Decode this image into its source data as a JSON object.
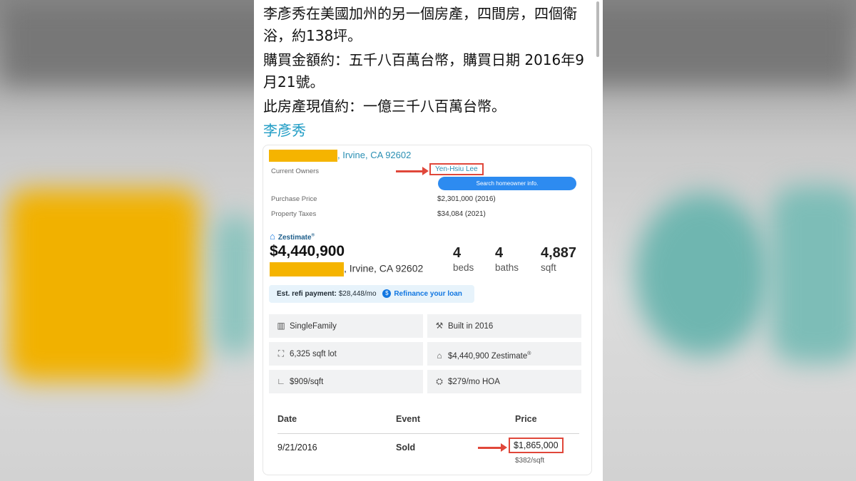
{
  "post": {
    "line1": "李彥秀在美國加州的另一個房產，四間房，四個衛浴，約138坪。",
    "line2": "購買金額約：五千八百萬台幣，購買日期 2016年9月21號。",
    "line3": "此房產現值約：一億三千八百萬台幣。",
    "author_tag": "李彥秀"
  },
  "card": {
    "top_address": ", Irvine, CA 92602",
    "current_owners_label": "Current Owners",
    "owner_name": "Yen-Hsiu Lee",
    "search_button": "Search homeowner info.",
    "purchase_price_label": "Purchase Price",
    "purchase_price_value": "$2,301,000 (2016)",
    "property_taxes_label": "Property Taxes",
    "property_taxes_value": "$34,084 (2021)",
    "zestimate_label": "Zestimate",
    "zestimate_reg": "®",
    "zestimate_price": "$4,440,900",
    "address": ", Irvine, CA 92602",
    "beds_num": "4",
    "beds_label": "beds",
    "baths_num": "4",
    "baths_label": "baths",
    "sqft_num": "4,887",
    "sqft_label": "sqft",
    "refi_label": "Est. refi payment:",
    "refi_value": "$28,448/mo",
    "refi_coin": "$",
    "refi_link": "Refinance your loan",
    "facts": {
      "type": "SingleFamily",
      "built": "Built in 2016",
      "lot": "6,325 sqft lot",
      "zest_fact": "$4,440,900 Zestimate",
      "zest_fact_reg": "®",
      "price_sqft": "$909/sqft",
      "hoa": "$279/mo HOA"
    },
    "history": {
      "headers": [
        "Date",
        "Event",
        "Price"
      ],
      "date": "9/21/2016",
      "event": "Sold",
      "price": "$1,865,000",
      "per_sqft": "$382/sqft"
    }
  },
  "colors": {
    "highlight": "#e0473a",
    "redaction": "#f5b400",
    "link": "#2a8fb3",
    "button": "#2d8bf0"
  },
  "icons": [
    "zillow-icon",
    "building-icon",
    "hammer-icon",
    "lot-icon",
    "zestimate-icon",
    "ruler-icon",
    "hoa-icon",
    "coin-icon"
  ]
}
